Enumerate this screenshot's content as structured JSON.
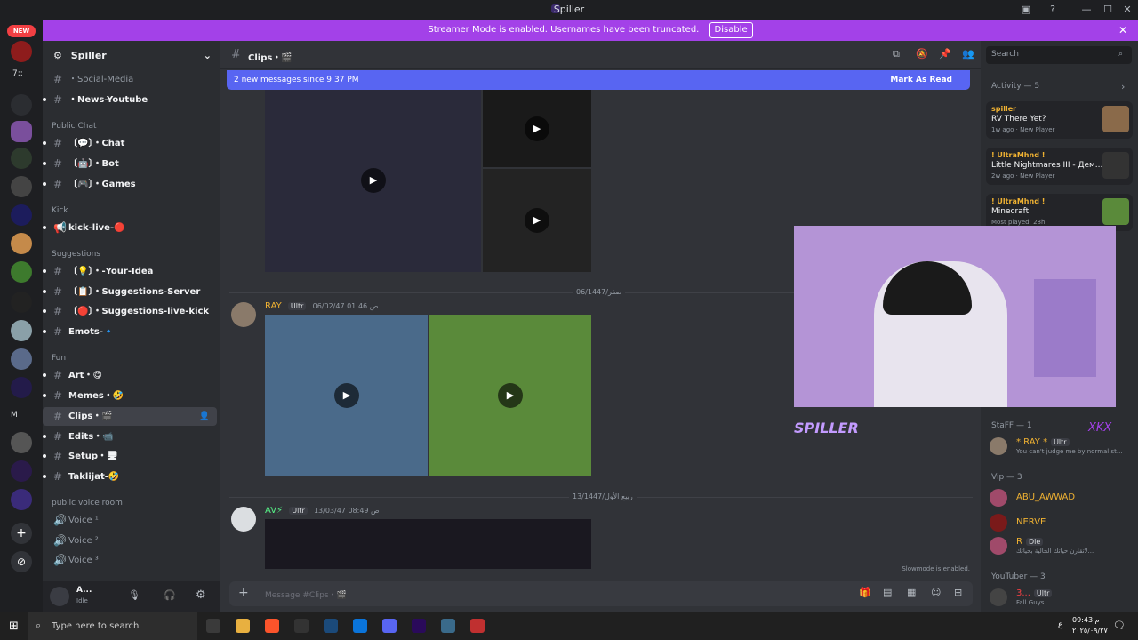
{
  "app": {
    "title": "Spiller"
  },
  "banner": {
    "text": "Streamer Mode is enabled. Usernames have been truncated.",
    "disable_label": "Disable"
  },
  "servers": {
    "new_badge": "NEW",
    "label_7": "7::",
    "label_m": "M"
  },
  "sidebar": {
    "server_name": "Spiller",
    "items": [
      {
        "label": "・Social-Media",
        "kind": "text"
      },
      {
        "label": "・News-Youtube",
        "kind": "text"
      },
      {
        "label": "Public Chat",
        "kind": "category"
      },
      {
        "label": "〔💬〕・Chat",
        "kind": "text"
      },
      {
        "label": "〔🤖〕・Bot",
        "kind": "text"
      },
      {
        "label": "〔🎮〕・Games",
        "kind": "text"
      },
      {
        "label": "Kick",
        "kind": "category"
      },
      {
        "label": "kick-live-🔴",
        "kind": "text"
      },
      {
        "label": "Suggestions",
        "kind": "category"
      },
      {
        "label": "〔💡〕・-Your-Idea",
        "kind": "text"
      },
      {
        "label": "〔📋〕・Suggestions-Server",
        "kind": "text"
      },
      {
        "label": "〔🔴〕・Suggestions-live-kick",
        "kind": "text"
      },
      {
        "label": "Emots-🔹",
        "kind": "text"
      },
      {
        "label": "Fun",
        "kind": "category"
      },
      {
        "label": "Art・😋",
        "kind": "text"
      },
      {
        "label": "Memes・🤣",
        "kind": "text"
      },
      {
        "label": "Clips・🎬",
        "kind": "text"
      },
      {
        "label": "Edits・📹",
        "kind": "text"
      },
      {
        "label": "Setup・🖥",
        "kind": "text"
      },
      {
        "label": "Taklijat-🤣",
        "kind": "text"
      },
      {
        "label": "public voice room",
        "kind": "category"
      },
      {
        "label": "Voice ¹",
        "kind": "voice"
      },
      {
        "label": "Voice ²",
        "kind": "voice"
      },
      {
        "label": "Voice ³",
        "kind": "voice"
      }
    ]
  },
  "user": {
    "name": "A...",
    "status": "Idle"
  },
  "channel": {
    "name": "Clips・🎬",
    "new_messages": "2 new messages since 9:37 PM",
    "mark_as_read": "Mark As Read"
  },
  "messages": [
    {
      "divider": "06/1447/صفر"
    },
    {
      "author": "RAY",
      "badge": "Ultr",
      "timestamp": "06/02/47 01:46 ص"
    },
    {
      "divider": "13/1447/ربيع الأول"
    },
    {
      "author": "AV⚡",
      "badge": "Ultr",
      "timestamp": "13/03/47 08:49 ص"
    }
  ],
  "slowmode": "Slowmode is enabled.",
  "composer": {
    "placeholder": "Message #Clips・🎬"
  },
  "search": {
    "placeholder": "Search"
  },
  "activity": {
    "header": "Activity — 5",
    "items": [
      {
        "name": "spiller",
        "game": "RV There Yet?",
        "sub": "1w ago",
        "tag": "New Player"
      },
      {
        "name": "! UltraMhnd !",
        "game": "Little Nightmares III - Дем...",
        "sub": "2w ago",
        "tag": "New Player"
      },
      {
        "name": "! UltraMhnd !",
        "game": "Minecraft",
        "sub": "Most played: 28h"
      }
    ]
  },
  "members": {
    "groups": [
      {
        "label": "StaFF — 1"
      },
      {
        "label": "Vip — 3"
      },
      {
        "label": "YouTuber — 3"
      }
    ],
    "list": [
      {
        "name": "* RAY *",
        "badge": "Ultr",
        "sub": "You can't judge me by normal st..."
      },
      {
        "name": "ABU_AWWAD"
      },
      {
        "name": "NERVE"
      },
      {
        "name": "R",
        "badge": "Dle",
        "sub": "لاتقارن حياتك الحالية بحياتك..."
      },
      {
        "name": "3...",
        "badge": "Ultr",
        "sub": "Fall Guys"
      }
    ]
  },
  "overlay": {
    "name": "SPILLER",
    "tag": "XKX"
  },
  "taskbar": {
    "search_placeholder": "Type here to search",
    "time": "09:43 م",
    "date": "٢٠٢٥/٠٩/٢٧",
    "lang": "ع"
  },
  "colors": {
    "accent": "#5865f2",
    "banner": "#a341e8",
    "bg": "#313338",
    "sidebar": "#2b2d31"
  }
}
